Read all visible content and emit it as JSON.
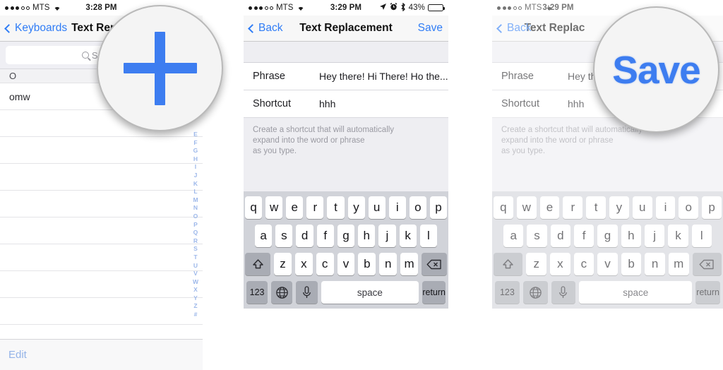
{
  "panels": [
    {
      "id": "text-replacement-list",
      "status_bar": {
        "carrier": "MTS",
        "time": "3:28 PM",
        "signal_filled": 3,
        "signal_hollow": 2,
        "wifi_icon": "wifi-icon"
      },
      "nav": {
        "back_label": "Keyboards",
        "title": "Text Replacement",
        "back_icon": "chevron-left-icon"
      },
      "search": {
        "placeholder": "Search",
        "value": "",
        "icon": "search-icon"
      },
      "section_header": "O",
      "rows": [
        "omw"
      ],
      "empty_row_count": 8,
      "index_letters": [
        "E",
        "F",
        "G",
        "H",
        "I",
        "J",
        "K",
        "L",
        "M",
        "N",
        "O",
        "P",
        "Q",
        "R",
        "S",
        "T",
        "U",
        "V",
        "W",
        "X",
        "Y",
        "Z",
        "#"
      ],
      "toolbar": {
        "edit_label": "Edit"
      }
    },
    {
      "id": "text-replacement-edit",
      "status_bar": {
        "carrier": "MTS",
        "time": "3:29 PM",
        "signal_filled": 3,
        "signal_hollow": 2,
        "wifi_icon": "wifi-icon",
        "location_icon": "location-arrow-icon",
        "alarm_icon": "alarm-clock-icon",
        "bluetooth_icon": "bluetooth-icon",
        "battery_percent": "43%",
        "battery_icon": "battery-icon"
      },
      "nav": {
        "back_label": "Back",
        "title": "Text Replacement",
        "save_label": "Save",
        "back_icon": "chevron-left-icon"
      },
      "form": {
        "phrase_label": "Phrase",
        "phrase_value": "Hey there! Hi There! Ho the...",
        "shortcut_label": "Shortcut",
        "shortcut_value": "hhh"
      },
      "hint": "Create a shortcut that will automatically\nexpand into the word or phrase\nas you type."
    },
    {
      "id": "text-replacement-save",
      "status_bar": {
        "carrier": "MTS",
        "time": "3:29 PM",
        "signal_filled": 3,
        "signal_hollow": 2,
        "wifi_icon": "wifi-icon"
      },
      "nav": {
        "back_label": "Back",
        "title": "Text Replac",
        "back_icon": "chevron-left-icon"
      },
      "form": {
        "phrase_label": "Phrase",
        "phrase_value": "Hey the",
        "shortcut_label": "Shortcut",
        "shortcut_value": "hhh"
      },
      "hint": "Create a shortcut that will automatically\nexpand into the word or phrase\nas you type."
    }
  ],
  "keyboard": {
    "row1": [
      "q",
      "w",
      "e",
      "r",
      "t",
      "y",
      "u",
      "i",
      "o",
      "p"
    ],
    "row2": [
      "a",
      "s",
      "d",
      "f",
      "g",
      "h",
      "j",
      "k",
      "l"
    ],
    "row3": [
      "z",
      "x",
      "c",
      "v",
      "b",
      "n",
      "m"
    ],
    "shift_icon": "shift-arrow-icon",
    "delete_icon": "delete-backspace-icon",
    "numbers_label": "123",
    "globe_icon": "globe-icon",
    "mic_icon": "microphone-icon",
    "space_label": "space",
    "return_label": "return"
  },
  "callouts": {
    "plus": {
      "icon": "plus-icon",
      "label": ""
    },
    "save": {
      "label": "Save"
    }
  },
  "colors": {
    "accent_blue": "#3d7df0",
    "link_blue": "#2f7cf6",
    "keyboard_bg": "#d1d3d9",
    "form_bg": "#eeeef2"
  }
}
